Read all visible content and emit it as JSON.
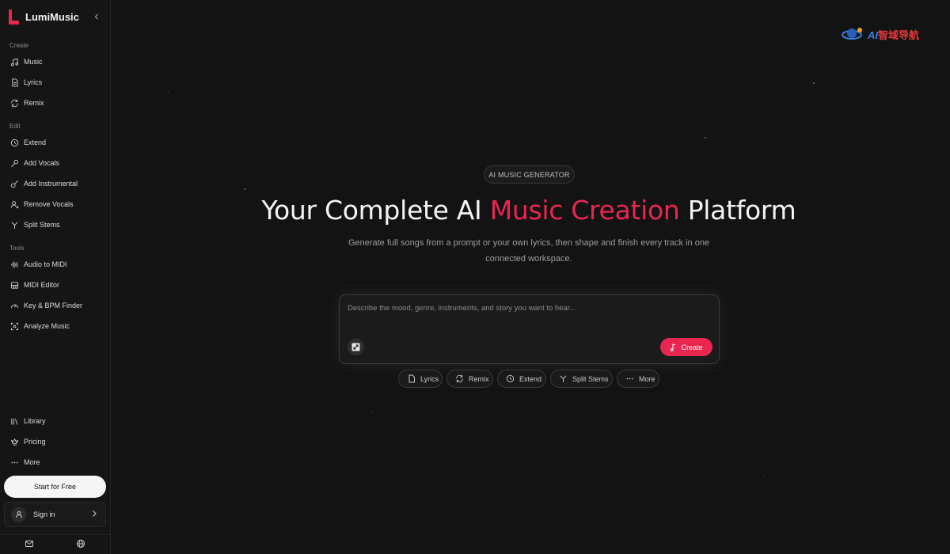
{
  "brand": {
    "name": "LumiMusic"
  },
  "sidebar": {
    "sections": {
      "create": "Create",
      "edit": "Edit",
      "tools": "Tools"
    },
    "create_items": [
      "Music",
      "Lyrics",
      "Remix"
    ],
    "edit_items": [
      "Extend",
      "Add Vocals",
      "Add Instrumental",
      "Remove Vocals",
      "Split Stems"
    ],
    "tools_items": [
      "Audio to MIDI",
      "MIDI Editor",
      "Key & BPM Finder",
      "Analyze Music"
    ],
    "bottom_items": [
      "Library",
      "Pricing",
      "More"
    ],
    "start_label": "Start for Free",
    "signin_label": "Sign in"
  },
  "watermark": {
    "prefix": "AI",
    "suffix": "智域导航"
  },
  "hero": {
    "badge": "AI MUSIC GENERATOR",
    "headline_pre": "Your Complete AI ",
    "headline_accent": "Music Creation",
    "headline_post": " Platform",
    "subtitle": "Generate full songs from a prompt or your own lyrics, then shape and finish every track in one connected workspace."
  },
  "prompt": {
    "placeholder": "Describe the mood, genre, instruments, and story you want to hear...",
    "create_label": "Create"
  },
  "chips": [
    "Lyrics",
    "Remix",
    "Extend",
    "Split Stems",
    "More"
  ],
  "colors": {
    "accent": "#e8264f",
    "background": "#131313"
  }
}
